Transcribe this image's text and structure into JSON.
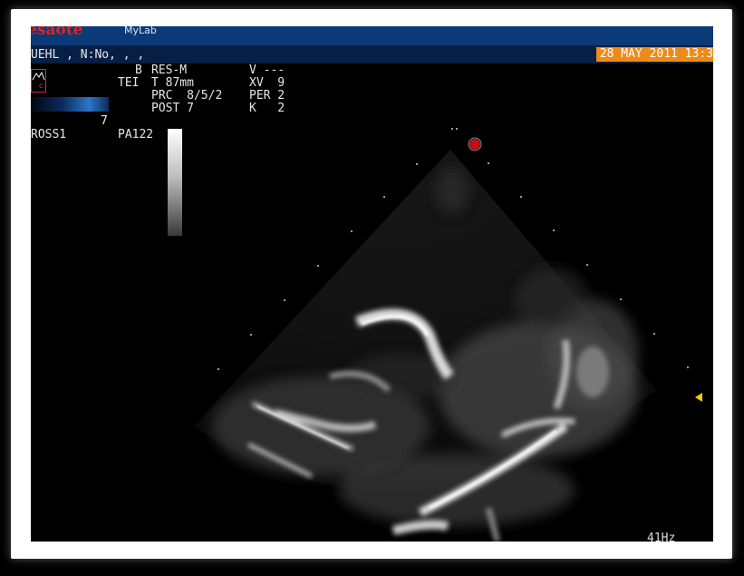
{
  "header": {
    "brand": "esaote",
    "brand_sub": "MyLab",
    "patient": "UEHL , N:No, , ,",
    "datetime": "28 MAY 2011 13:3"
  },
  "params": {
    "b": "B",
    "res": "RES-M",
    "v": "V ---",
    "tei": "TEI",
    "t": "T 87mm",
    "xv": "XV  9",
    "prc": "PRC  8/5/2",
    "per": "PER 2",
    "post": "POST 7",
    "k": "K   2",
    "gain": "7",
    "probe": "ROSS1",
    "preset": "PA122"
  },
  "icons": {
    "mode": "mode-c-icon",
    "depth_marker": "triangle-marker-icon",
    "focus": "focus-marker-icon"
  },
  "footer": {
    "frame_rate": "41Hz"
  },
  "colors": {
    "brand_bar": "#0a3a78",
    "patient_bar": "#081f45",
    "datetime_bg": "#f08a16",
    "brand_text": "#e1231c",
    "depth_marker": "#f2d000"
  }
}
